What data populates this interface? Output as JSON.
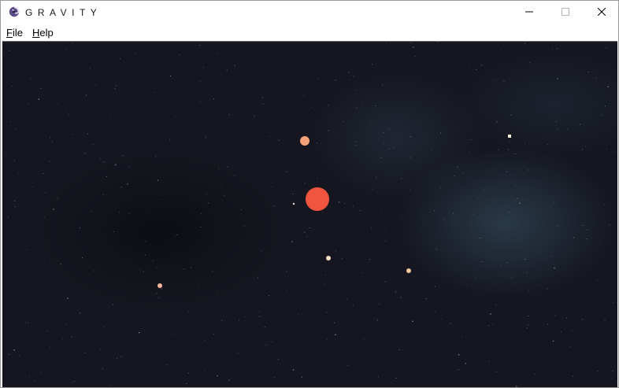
{
  "window": {
    "title": "GRAVITY",
    "icon": "gravity-swirl-icon"
  },
  "window_controls": {
    "minimize_icon": "minimize-icon",
    "maximize_icon": "maximize-icon",
    "close_icon": "close-icon"
  },
  "menu": {
    "items": [
      {
        "mnemonic": "F",
        "rest": "ile"
      },
      {
        "mnemonic": "H",
        "rest": "elp"
      }
    ]
  },
  "simulation": {
    "background_color": "#15161f",
    "bodies": [
      {
        "name": "star",
        "color": "#f05540"
      },
      {
        "name": "planet-orange",
        "color": "#f4a27a"
      },
      {
        "name": "planet-small-1",
        "color": "#fbe3cd"
      },
      {
        "name": "planet-small-2",
        "color": "#f9c99f"
      },
      {
        "name": "planet-small-3",
        "color": "#f8b8a0"
      },
      {
        "name": "planet-small-4",
        "color": "#fff4dc"
      },
      {
        "name": "moonlet",
        "color": "#e8e0d8"
      }
    ]
  }
}
